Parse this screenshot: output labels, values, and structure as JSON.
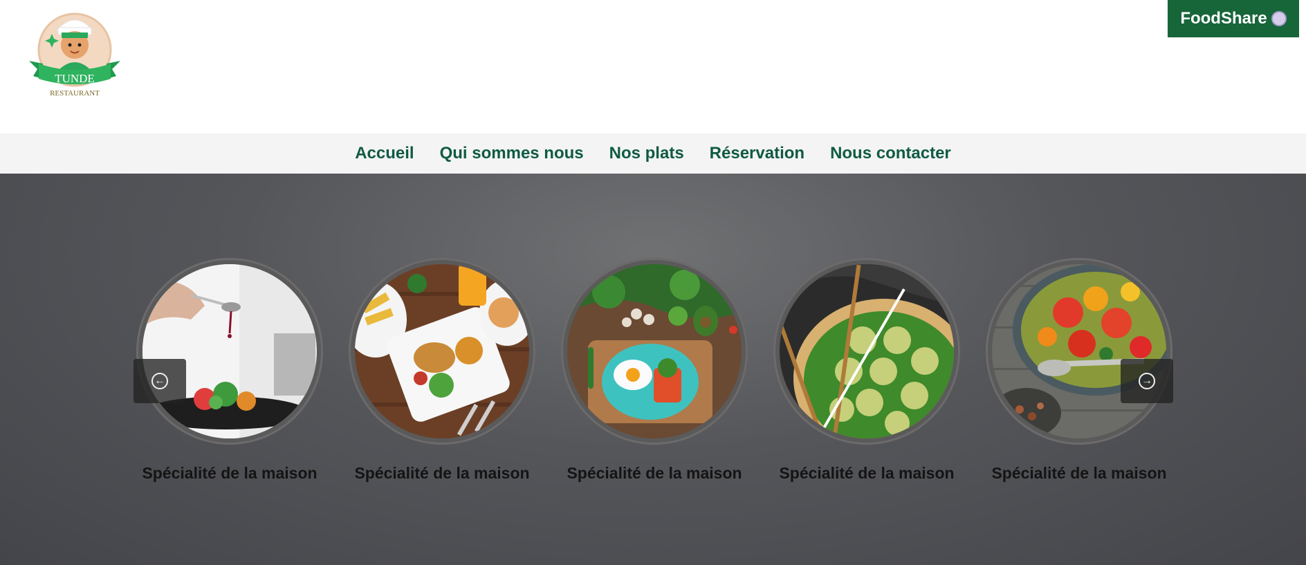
{
  "brand": {
    "logo_text_main": "TUNDE",
    "logo_text_sub": "RESTAURANT",
    "badge_label": "FoodShare",
    "badge_icon": "plate-icon"
  },
  "nav": {
    "items": [
      {
        "label": "Accueil"
      },
      {
        "label": "Qui sommes nous"
      },
      {
        "label": "Nos plats"
      },
      {
        "label": "Réservation"
      },
      {
        "label": "Nous contacter"
      }
    ]
  },
  "carousel": {
    "prev_icon": "arrow-left-circle-icon",
    "next_icon": "arrow-right-circle-icon",
    "cards": [
      {
        "caption": "Spécialité de la maison",
        "image": "chef-plating-salad"
      },
      {
        "caption": "Spécialité de la maison",
        "image": "roast-chicken-plates"
      },
      {
        "caption": "Spécialité de la maison",
        "image": "healthy-breakfast-board"
      },
      {
        "caption": "Spécialité de la maison",
        "image": "dim-sum-chopsticks"
      },
      {
        "caption": "Spécialité de la maison",
        "image": "tomato-salad-bowl"
      }
    ]
  },
  "colors": {
    "brand_green": "#17663a",
    "nav_text": "#0f5a43",
    "nav_bg": "#f4f4f4",
    "hero_bg": "#55565a"
  }
}
